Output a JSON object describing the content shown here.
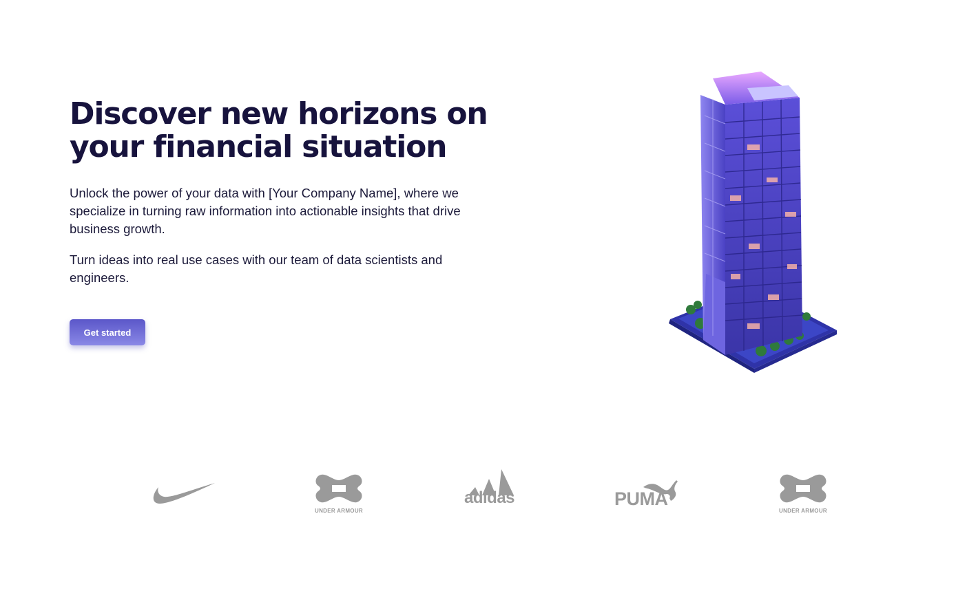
{
  "hero": {
    "title": "Discover new horizons on your financial situation",
    "paragraph_1": "Unlock the power of your data with [Your Company Name], where we specialize in turning raw information into actionable insights that drive business growth.",
    "paragraph_2": "Turn ideas into real use cases with our team of data scientists and engineers.",
    "cta_label": "Get started"
  },
  "illustration": {
    "name": "isometric-skyscraper"
  },
  "colors": {
    "heading": "#17133d",
    "body_text": "#1c1a3a",
    "button_top": "#5b57c9",
    "button_bottom": "#8a88e6",
    "logo_gray": "#9a9a9a"
  },
  "partner_logos": [
    {
      "brand": "Nike",
      "icon": "nike-swoosh-icon"
    },
    {
      "brand": "Under Armour",
      "icon": "under-armour-icon",
      "wordmark": "UNDER ARMOUR"
    },
    {
      "brand": "Adidas",
      "icon": "adidas-icon",
      "wordmark": "adidas"
    },
    {
      "brand": "Puma",
      "icon": "puma-icon",
      "wordmark": "PUMA"
    },
    {
      "brand": "Under Armour",
      "icon": "under-armour-icon",
      "wordmark": "UNDER ARMOUR"
    }
  ]
}
